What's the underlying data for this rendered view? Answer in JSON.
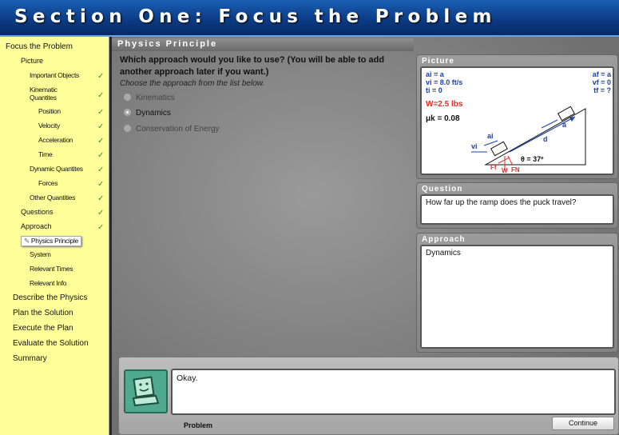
{
  "header": {
    "title": "Section One: Focus the Problem"
  },
  "sidebar": {
    "items": [
      {
        "label": "Focus the Problem"
      },
      {
        "label": "Picture"
      },
      {
        "label": "Important Objects",
        "checked": true
      },
      {
        "label": "Kinematic",
        "label2": "Quantites",
        "checked": true
      },
      {
        "label": "Position",
        "checked": true
      },
      {
        "label": "Velocity",
        "checked": true
      },
      {
        "label": "Acceleration",
        "checked": true
      },
      {
        "label": "Time",
        "checked": true
      },
      {
        "label": "Dynamic Quantites",
        "checked": true
      },
      {
        "label": "Forces",
        "checked": true
      },
      {
        "label": "Other Quantities",
        "checked": true
      },
      {
        "label": "Questions",
        "checked": true
      },
      {
        "label": "Approach",
        "checked": true
      },
      {
        "label": "Physics Principle",
        "selected": true
      },
      {
        "label": "System"
      },
      {
        "label": "Relevant Times"
      },
      {
        "label": "Relevant Info"
      },
      {
        "label": "Describe the Physics"
      },
      {
        "label": "Plan the Solution"
      },
      {
        "label": "Execute the Plan"
      },
      {
        "label": "Evaluate the Solution"
      },
      {
        "label": "Summary"
      }
    ],
    "check_glyph": "✓"
  },
  "main": {
    "section_title": "Physics Principle",
    "prompt": "Which approach would you like to use? (You will be able to add another approach later if you want.)",
    "instruction": "Choose the approach from the list below.",
    "options": [
      {
        "label": "Kinematics",
        "selected": false
      },
      {
        "label": "Dynamics",
        "selected": true
      },
      {
        "label": "Conservation of Energy",
        "selected": false
      }
    ]
  },
  "picture_panel": {
    "title": "Picture",
    "diagram": {
      "ai": "ai = a",
      "vi": "vi = 8.0 ft/s",
      "ti": "ti = 0",
      "af": "af = a",
      "vf": "vf = 0",
      "tf": "tf = ?",
      "weight": "W=2.5 lbs",
      "mu": "μk = 0.08",
      "angle": "θ = 37º",
      "distance": "d",
      "vec_a": "a",
      "vec_v": "vi",
      "vec_ai": "ai",
      "force_f": "Ff",
      "force_w": "W",
      "force_n": "FN"
    }
  },
  "question_panel": {
    "title": "Question",
    "text": "How far up the ramp does the puck travel?"
  },
  "approach_panel": {
    "title": "Approach",
    "text": "Dynamics"
  },
  "dialog": {
    "message": "Okay.",
    "problem_label": "Problem",
    "continue_label": "Continue"
  },
  "colors": {
    "header": "#0c3c86",
    "sidebar": "#ffff99",
    "checkmark": "#3a8a3a",
    "avatar": "#4faa8f",
    "diagram_blue": "#1a3fb0",
    "diagram_red": "#d9312b"
  }
}
